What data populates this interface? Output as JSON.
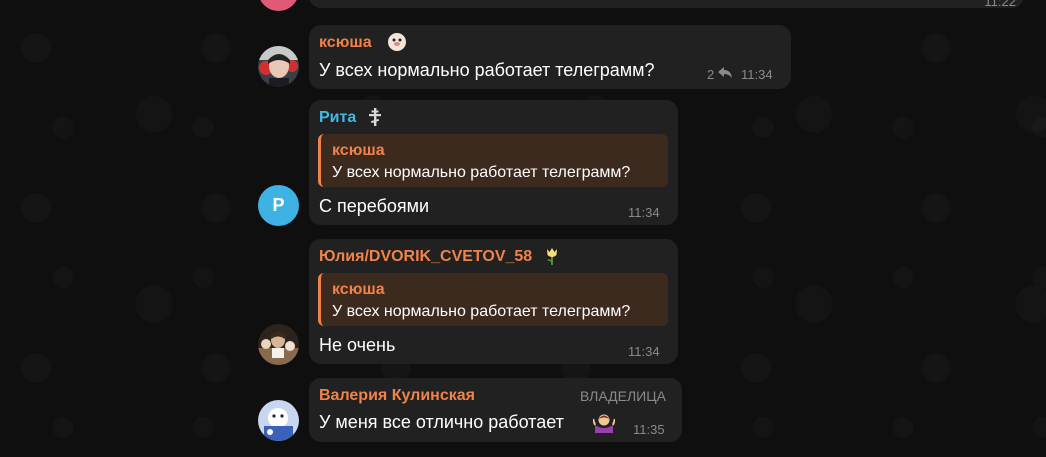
{
  "colors": {
    "orange_name": "#f0824a",
    "blue_name": "#42b9e6",
    "bubble": "#212121",
    "quote_bg": "#3d2a1f",
    "meta": "#8a8a8a"
  },
  "top_message": {
    "time": "11:22"
  },
  "messages": [
    {
      "sender": "ксюша",
      "sender_emoji_icon": "seal-emoji-icon",
      "text": "У всех нормально работает телеграмм?",
      "reply_count": "2",
      "reply_icon": "reply-arrow-icon",
      "time": "11:34"
    },
    {
      "sender": "Рита",
      "sender_emoji_icon": "orthodox-cross-emoji-icon",
      "avatar_letter": "Р",
      "quote": {
        "name": "ксюша",
        "text": "У всех нормально работает телеграмм?"
      },
      "text": "С перебоями",
      "time": "11:34"
    },
    {
      "sender": "Юлия/DVORIK_CVETOV_58",
      "sender_emoji_icon": "tulip-emoji-icon",
      "quote": {
        "name": "ксюша",
        "text": "У всех нормально работает телеграмм?"
      },
      "text": "Не очень",
      "time": "11:34"
    },
    {
      "sender": "Валерия Кулинская",
      "role": "ВЛАДЕЛИЦА",
      "text": "У меня все отлично работает",
      "text_emoji_icon": "shrug-emoji-icon",
      "time": "11:35"
    }
  ]
}
